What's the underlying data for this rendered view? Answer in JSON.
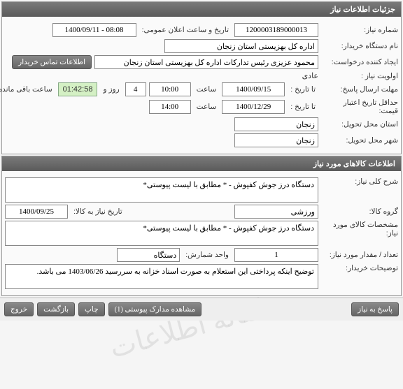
{
  "panel1": {
    "title": "جزئیات اطلاعات نیاز",
    "need_number_label": "شماره نیاز:",
    "need_number": "1200003189000013",
    "announce_label": "تاریخ و ساعت اعلان عمومی:",
    "announce_value": "1400/09/11 - 08:08",
    "buyer_label": "نام دستگاه خریدار:",
    "buyer_value": "اداره کل بهزیستی استان زنجان",
    "creator_label": "ایجاد کننده درخواست:",
    "creator_value": "محمود عزیزی رئیس تدارکات اداره کل بهزیستی استان زنجان",
    "contact_btn": "اطلاعات تماس خریدار",
    "priority_label": "اولویت نیاز :",
    "priority_value": "عادی",
    "deadline_label": "مهلت ارسال پاسخ:",
    "to_date_label": "تا تاریخ :",
    "deadline_date": "1400/09/15",
    "time_label": "ساعت",
    "deadline_time": "10:00",
    "days_remain": "4",
    "days_and": "روز و",
    "countdown": "01:42:58",
    "remain_label": "ساعت باقی مانده",
    "validity_label": "حداقل تاریخ اعتبار قیمت:",
    "validity_date": "1400/12/29",
    "validity_time": "14:00",
    "province_label": "استان محل تحویل:",
    "province_value": "زنجان",
    "city_label": "شهر محل تحویل:",
    "city_value": "زنجان"
  },
  "panel2": {
    "title": "اطلاعات کالاهای مورد نیاز",
    "desc_label": "شرح کلی نیاز:",
    "desc_value": "دستگاه درز جوش کفپوش - * مطابق با لیست پیوستی*",
    "group_label": "گروه کالا:",
    "group_value": "ورزشی",
    "date_need_label": "تاریخ نیاز به کالا:",
    "date_need_value": "1400/09/25",
    "spec_label": "مشخصات کالای مورد نیاز:",
    "spec_value": "دستگاه درز جوش کفپوش - * مطابق با لیست پیوستی*",
    "qty_label": "تعداد / مقدار مورد نیاز:",
    "qty_value": "1",
    "unit_label": "واحد شمارش:",
    "unit_value": "دستگاه",
    "notes_label": "توضیحات خریدار:",
    "notes_value": "توضیح اینکه پرداختی این استعلام به صورت اسناد خزانه به سررسید 1403/06/26 می باشد."
  },
  "footer": {
    "respond": "پاسخ به نیاز",
    "attach": "مشاهده مدارک پیوستی (1)",
    "print": "چاپ",
    "back": "بازگشت",
    "exit": "خروج"
  }
}
